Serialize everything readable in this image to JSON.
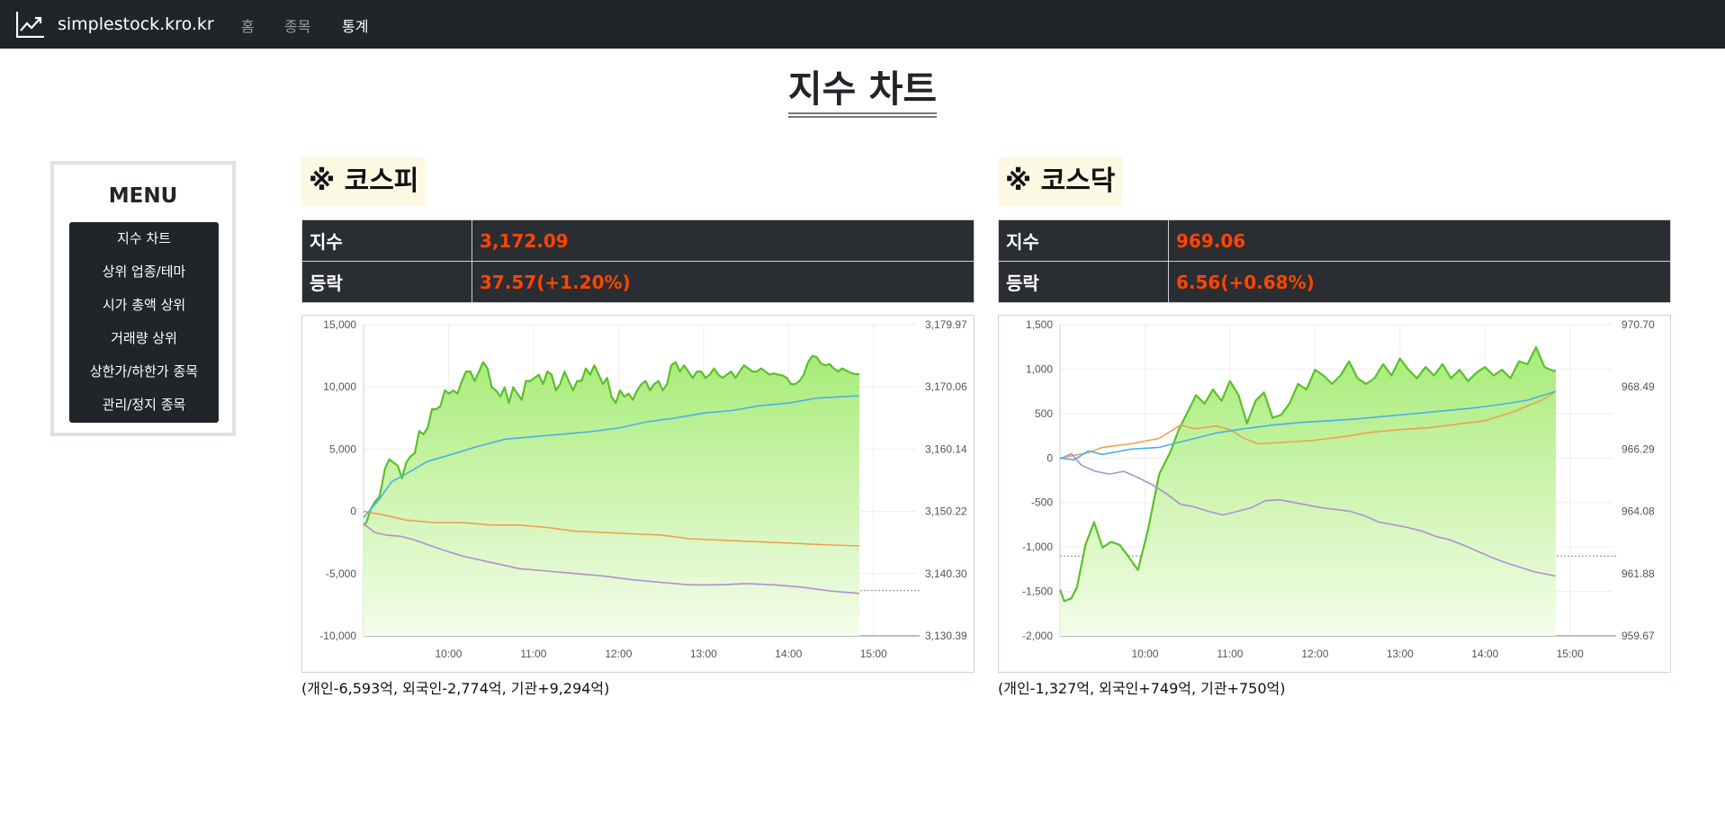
{
  "navbar": {
    "brand": "simplestock.kro.kr",
    "links": [
      "홈",
      "종목",
      "통계"
    ]
  },
  "page": {
    "title": "지수 차트"
  },
  "menu": {
    "title": "MENU",
    "items": [
      "지수 차트",
      "상위 업종/테마",
      "시가 총액 상위",
      "거래량 상위",
      "상한가/하한가 종목",
      "관리/정지 종목"
    ]
  },
  "colors": {
    "navbar_bg": "#212529",
    "value_red": "#ff4500",
    "series_total": "#5bc02a",
    "series_individual": "#f0a050",
    "series_foreign": "#b090d0",
    "series_institution": "#4ab0e8",
    "fill_top": "#a8ec78",
    "fill_bottom": "#f4fdea"
  },
  "kospi": {
    "title": "※ 코스피",
    "index_label": "지수",
    "index_value": "3,172.09",
    "change_label": "등락",
    "change_value": "37.57(+1.20%)",
    "summary": "(개인-6,593억, 외국인-2,774억, 기관+9,294억)"
  },
  "kosdaq": {
    "title": "※ 코스닥",
    "index_label": "지수",
    "index_value": "969.06",
    "change_label": "등락",
    "change_value": "6.56(+0.68%)",
    "summary": "(개인-1,327억, 외국인+749억, 기관+750억)"
  },
  "chart_data": [
    {
      "type": "line",
      "x_ticks": [
        "10:00",
        "11:00",
        "12:00",
        "13:00",
        "14:00",
        "15:00"
      ],
      "x_range": [
        "09:00",
        "15:30"
      ],
      "y_left_ticks": [
        "15,000",
        "10,000",
        "5,000",
        "0",
        "-5,000",
        "-10,000"
      ],
      "y_left_range": [
        -10000,
        15000
      ],
      "y_right_ticks": [
        "3,179.97",
        "3,170.06",
        "3,160.14",
        "3,150.22",
        "3,140.30",
        "3,130.39"
      ],
      "y_right_range": [
        3130.39,
        3179.97
      ],
      "reference_line_right": 3137.6,
      "grid": true,
      "legend": "none",
      "series": [
        {
          "axis": "right",
          "color_key": "series_total",
          "area": true,
          "x": [
            0,
            3,
            6,
            10,
            14,
            17,
            20,
            24,
            28,
            31,
            34,
            37,
            40,
            42,
            44,
            46,
            48,
            50,
            52,
            54,
            56,
            58,
            60,
            62,
            64,
            66,
            68,
            70,
            72,
            74,
            76,
            78,
            80,
            82,
            84,
            86,
            88,
            90,
            92,
            94,
            96,
            98,
            100,
            102,
            104,
            106,
            108,
            110,
            112,
            114,
            116,
            118,
            120,
            122,
            124,
            126,
            128,
            130,
            132,
            134,
            136,
            138,
            140,
            142,
            144,
            146,
            148,
            150,
            152,
            154,
            156,
            158,
            160,
            162,
            164,
            166,
            168,
            170,
            172,
            174,
            176,
            178,
            180,
            182,
            184,
            186,
            188,
            190,
            192,
            194,
            196,
            198,
            200,
            202,
            204,
            206,
            208,
            210,
            212,
            214,
            216,
            218,
            220,
            222,
            224,
            226,
            228,
            230,
            232,
            234,
            236,
            238,
            240,
            242,
            244,
            246,
            348
          ],
          "y": [
            3147.8,
            3150.2,
            3152,
            3154.5,
            3153.5,
            3153.5,
            3154.5,
            3155,
            3157,
            3156.5,
            3158,
            3158.5,
            3159,
            3160,
            3160.5,
            3160,
            3162,
            3163.5,
            3163,
            3164,
            3165,
            3164.5,
            3165.5,
            3166.5,
            3166.8,
            3167,
            3167.3,
            3167.5,
            3167.8,
            3168,
            3168.2,
            3168.4,
            3168.6,
            3168.8,
            3168.9,
            3169,
            3169.1,
            3169.2,
            3169.3,
            3169.4,
            3169.5,
            3169.6,
            3169.7,
            3169.8,
            3169.85,
            3169.9,
            3169.95,
            3170,
            3170.05,
            3170.1,
            3170.15,
            3170.2,
            3170.25,
            3170.3,
            3170.35,
            3170.4,
            3170.45,
            3170.5,
            3170.55,
            3170.6,
            3170.65,
            3170.7,
            3170.75,
            3170.8,
            3170.85,
            3170.9,
            3170.95,
            3171,
            3171.05,
            3171.1,
            3171.15,
            3171.2,
            3171.25,
            3171.3,
            3171.35,
            3171.4,
            3171.45,
            3171.5,
            3171.55,
            3171.6,
            3171.65,
            3171.7,
            3171.75,
            3171.8,
            3171.85,
            3171.9,
            3171.95,
            3172,
            3172.02,
            3172.04,
            3172.06,
            3172.07,
            3172.08,
            3172.09,
            3172.09,
            3172.09,
            3172.09,
            3172.09,
            3172.09,
            3172.09,
            3172.09,
            3172.09,
            3172.09,
            3172.09,
            3172.09,
            3172.09,
            3172.09,
            3172.09,
            3172.09,
            3172.09,
            3172.09,
            3172.09,
            3172.09,
            3172.09,
            3172.09,
            3172.09,
            3172.09
          ]
        }
      ]
    },
    {
      "type": "line",
      "x_ticks": [
        "10:00",
        "11:00",
        "12:00",
        "13:00",
        "14:00",
        "15:00"
      ],
      "x_range": [
        "09:00",
        "15:30"
      ],
      "y_left_ticks": [
        "1,500",
        "1,000",
        "500",
        "0",
        "-500",
        "-1,000",
        "-1,500",
        "-2,000"
      ],
      "y_left_range": [
        -2000,
        1500
      ],
      "y_right_ticks": [
        "970.70",
        "968.49",
        "966.29",
        "964.08",
        "961.88",
        "959.67"
      ],
      "y_right_range": [
        959.67,
        970.7
      ],
      "reference_line_right": 962.5,
      "grid": true,
      "legend": "none",
      "series": []
    }
  ]
}
